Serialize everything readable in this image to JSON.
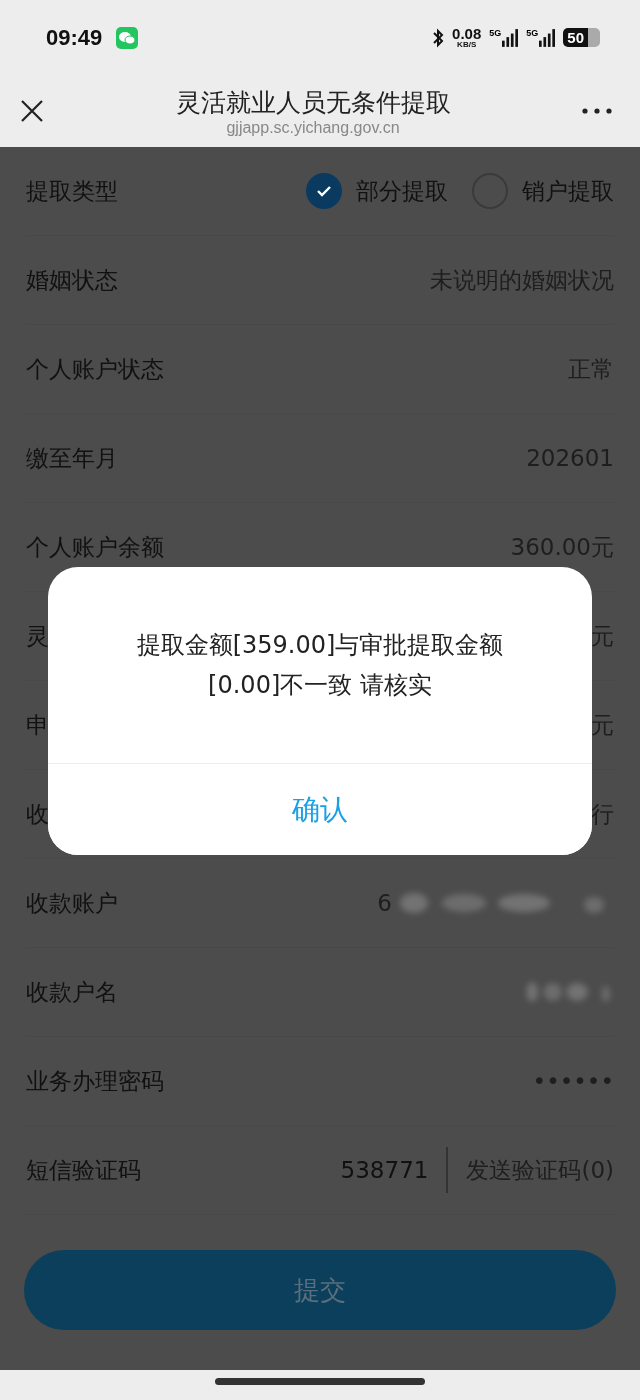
{
  "status_bar": {
    "time": "09:49",
    "speed": "0.08",
    "speed_unit": "KB/S",
    "network_1": "5G",
    "network_2": "5G",
    "battery": "50"
  },
  "nav": {
    "title": "灵活就业人员无条件提取",
    "url": "gjjapp.sc.yichang.gov.cn"
  },
  "form": {
    "type_label": "提取类型",
    "options": [
      {
        "label": "部分提取",
        "selected": true
      },
      {
        "label": "销户提取",
        "selected": false
      }
    ],
    "rows": [
      {
        "label": "婚姻状态",
        "value": "未说明的婚姻状况",
        "kind": "text"
      },
      {
        "label": "个人账户状态",
        "value": "正常",
        "kind": "text"
      },
      {
        "label": "缴至年月",
        "value": "202601",
        "kind": "text"
      },
      {
        "label": "个人账户余额",
        "value": "360.00元",
        "kind": "text"
      },
      {
        "label": "灵",
        "value": "元",
        "kind": "text"
      },
      {
        "label": "申",
        "value": "元",
        "kind": "text"
      },
      {
        "label": "收",
        "value": "行",
        "kind": "text"
      },
      {
        "label": "收款账户",
        "value": "6",
        "kind": "blurred"
      },
      {
        "label": "收款户名",
        "kind": "blurred"
      },
      {
        "label": "业务办理密码",
        "value": "••••••",
        "kind": "text"
      }
    ],
    "sms": {
      "label": "短信验证码",
      "value": "538771",
      "button": "发送验证码(0)"
    },
    "submit": "提交"
  },
  "dialog": {
    "message": "提取金额[359.00]与审批提取金额[0.00]不一致 请核实",
    "button": "确认"
  }
}
